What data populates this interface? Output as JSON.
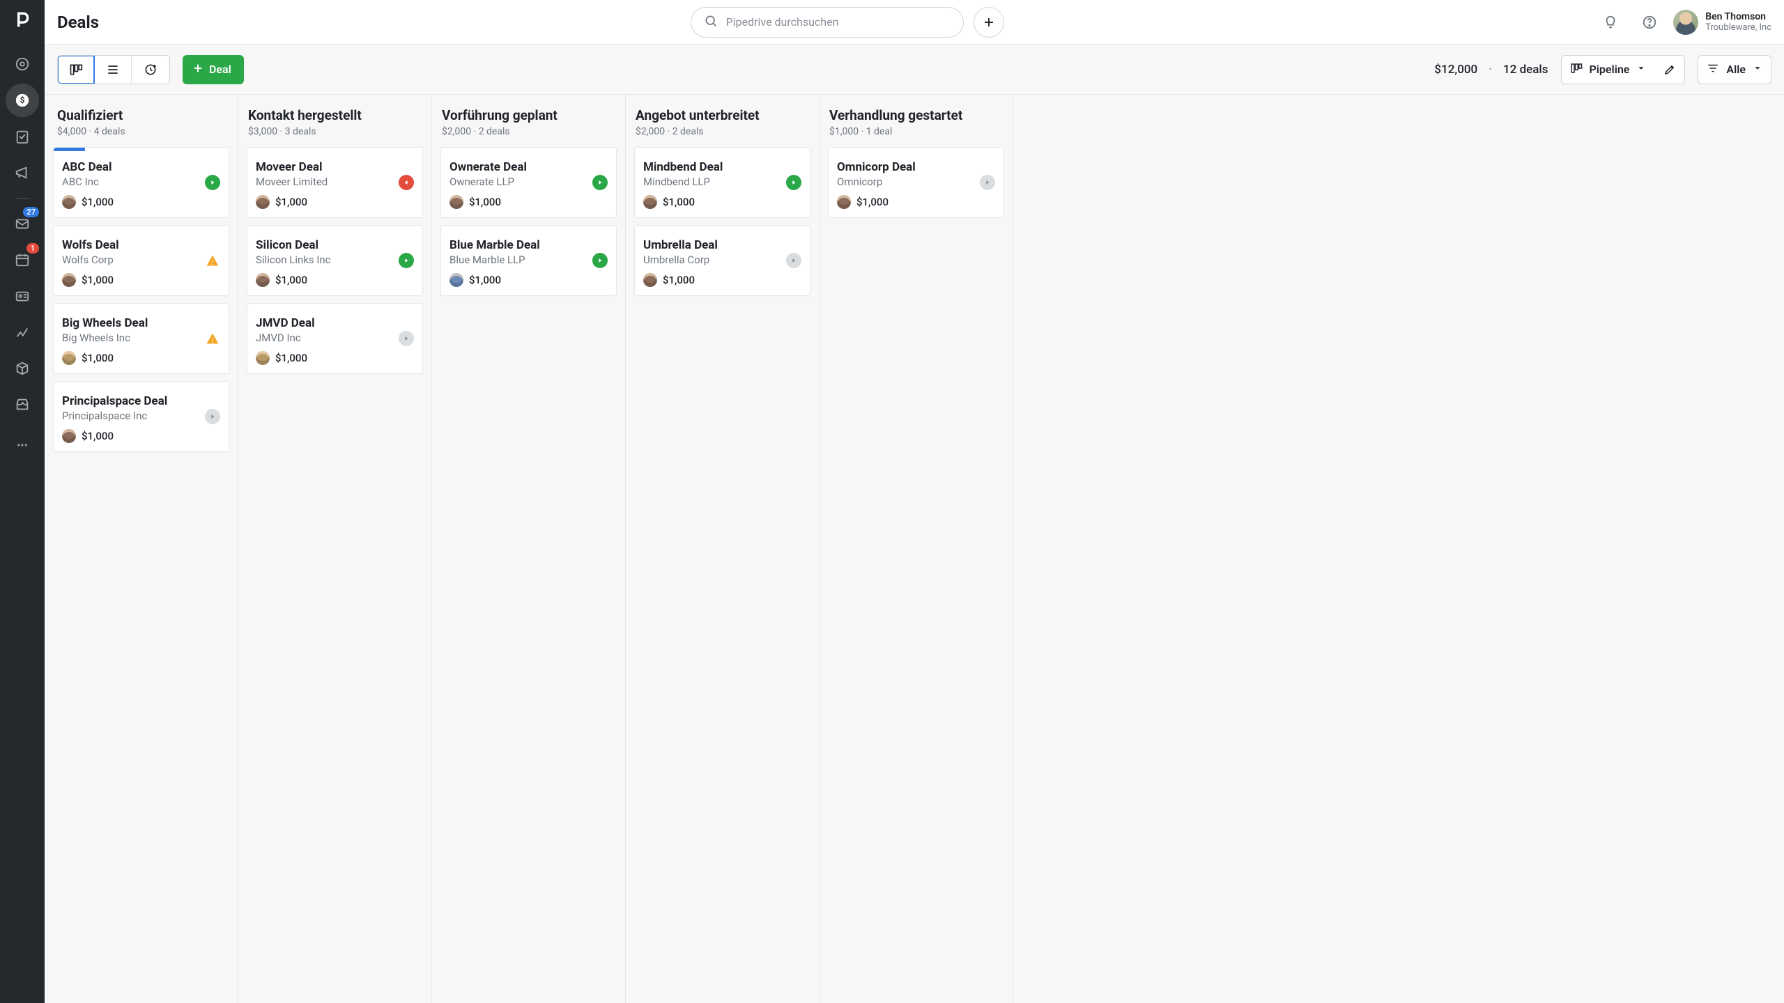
{
  "header": {
    "title": "Deals",
    "search_placeholder": "Pipedrive durchsuchen",
    "user": {
      "name": "Ben Thomson",
      "company": "Troubleware, Inc"
    }
  },
  "sidebar": {
    "mail_badge": "27",
    "calendar_badge": "1"
  },
  "toolbar": {
    "add_button": "Deal",
    "summary_amount": "$12,000",
    "summary_count": "12 deals",
    "pipeline_label": "Pipeline",
    "filter_label": "Alle"
  },
  "columns": [
    {
      "title": "Qualifiziert",
      "subtitle": "$4,000 · 4 deals",
      "cards": [
        {
          "title": "ABC Deal",
          "company": "ABC Inc",
          "amount": "$1,000",
          "status": "green",
          "progress": 18,
          "avatar": ""
        },
        {
          "title": "Wolfs Deal",
          "company": "Wolfs Corp",
          "amount": "$1,000",
          "status": "warn",
          "avatar": ""
        },
        {
          "title": "Big Wheels Deal",
          "company": "Big Wheels Inc",
          "amount": "$1,000",
          "status": "warn",
          "avatar": "alt"
        },
        {
          "title": "Principalspace Deal",
          "company": "Principalspace Inc",
          "amount": "$1,000",
          "status": "gray",
          "avatar": ""
        }
      ]
    },
    {
      "title": "Kontakt hergestellt",
      "subtitle": "$3,000 · 3 deals",
      "cards": [
        {
          "title": "Moveer Deal",
          "company": "Moveer Limited",
          "amount": "$1,000",
          "status": "red",
          "avatar": ""
        },
        {
          "title": "Silicon Deal",
          "company": "Silicon Links Inc",
          "amount": "$1,000",
          "status": "green",
          "avatar": ""
        },
        {
          "title": "JMVD Deal",
          "company": "JMVD Inc",
          "amount": "$1,000",
          "status": "gray",
          "avatar": "alt"
        }
      ]
    },
    {
      "title": "Vorführung geplant",
      "subtitle": "$2,000 · 2 deals",
      "cards": [
        {
          "title": "Ownerate Deal",
          "company": "Ownerate LLP",
          "amount": "$1,000",
          "status": "green",
          "avatar": ""
        },
        {
          "title": "Blue Marble Deal",
          "company": "Blue Marble LLP",
          "amount": "$1,000",
          "status": "green",
          "avatar": "alt2"
        }
      ]
    },
    {
      "title": "Angebot unterbreitet",
      "subtitle": "$2,000 · 2 deals",
      "cards": [
        {
          "title": "Mindbend Deal",
          "company": "Mindbend LLP",
          "amount": "$1,000",
          "status": "green",
          "avatar": ""
        },
        {
          "title": "Umbrella Deal",
          "company": "Umbrella Corp",
          "amount": "$1,000",
          "status": "gray",
          "avatar": ""
        }
      ]
    },
    {
      "title": "Verhandlung gestartet",
      "subtitle": "$1,000 · 1 deal",
      "cards": [
        {
          "title": "Omnicorp Deal",
          "company": "Omnicorp",
          "amount": "$1,000",
          "status": "gray",
          "avatar": ""
        }
      ]
    }
  ]
}
